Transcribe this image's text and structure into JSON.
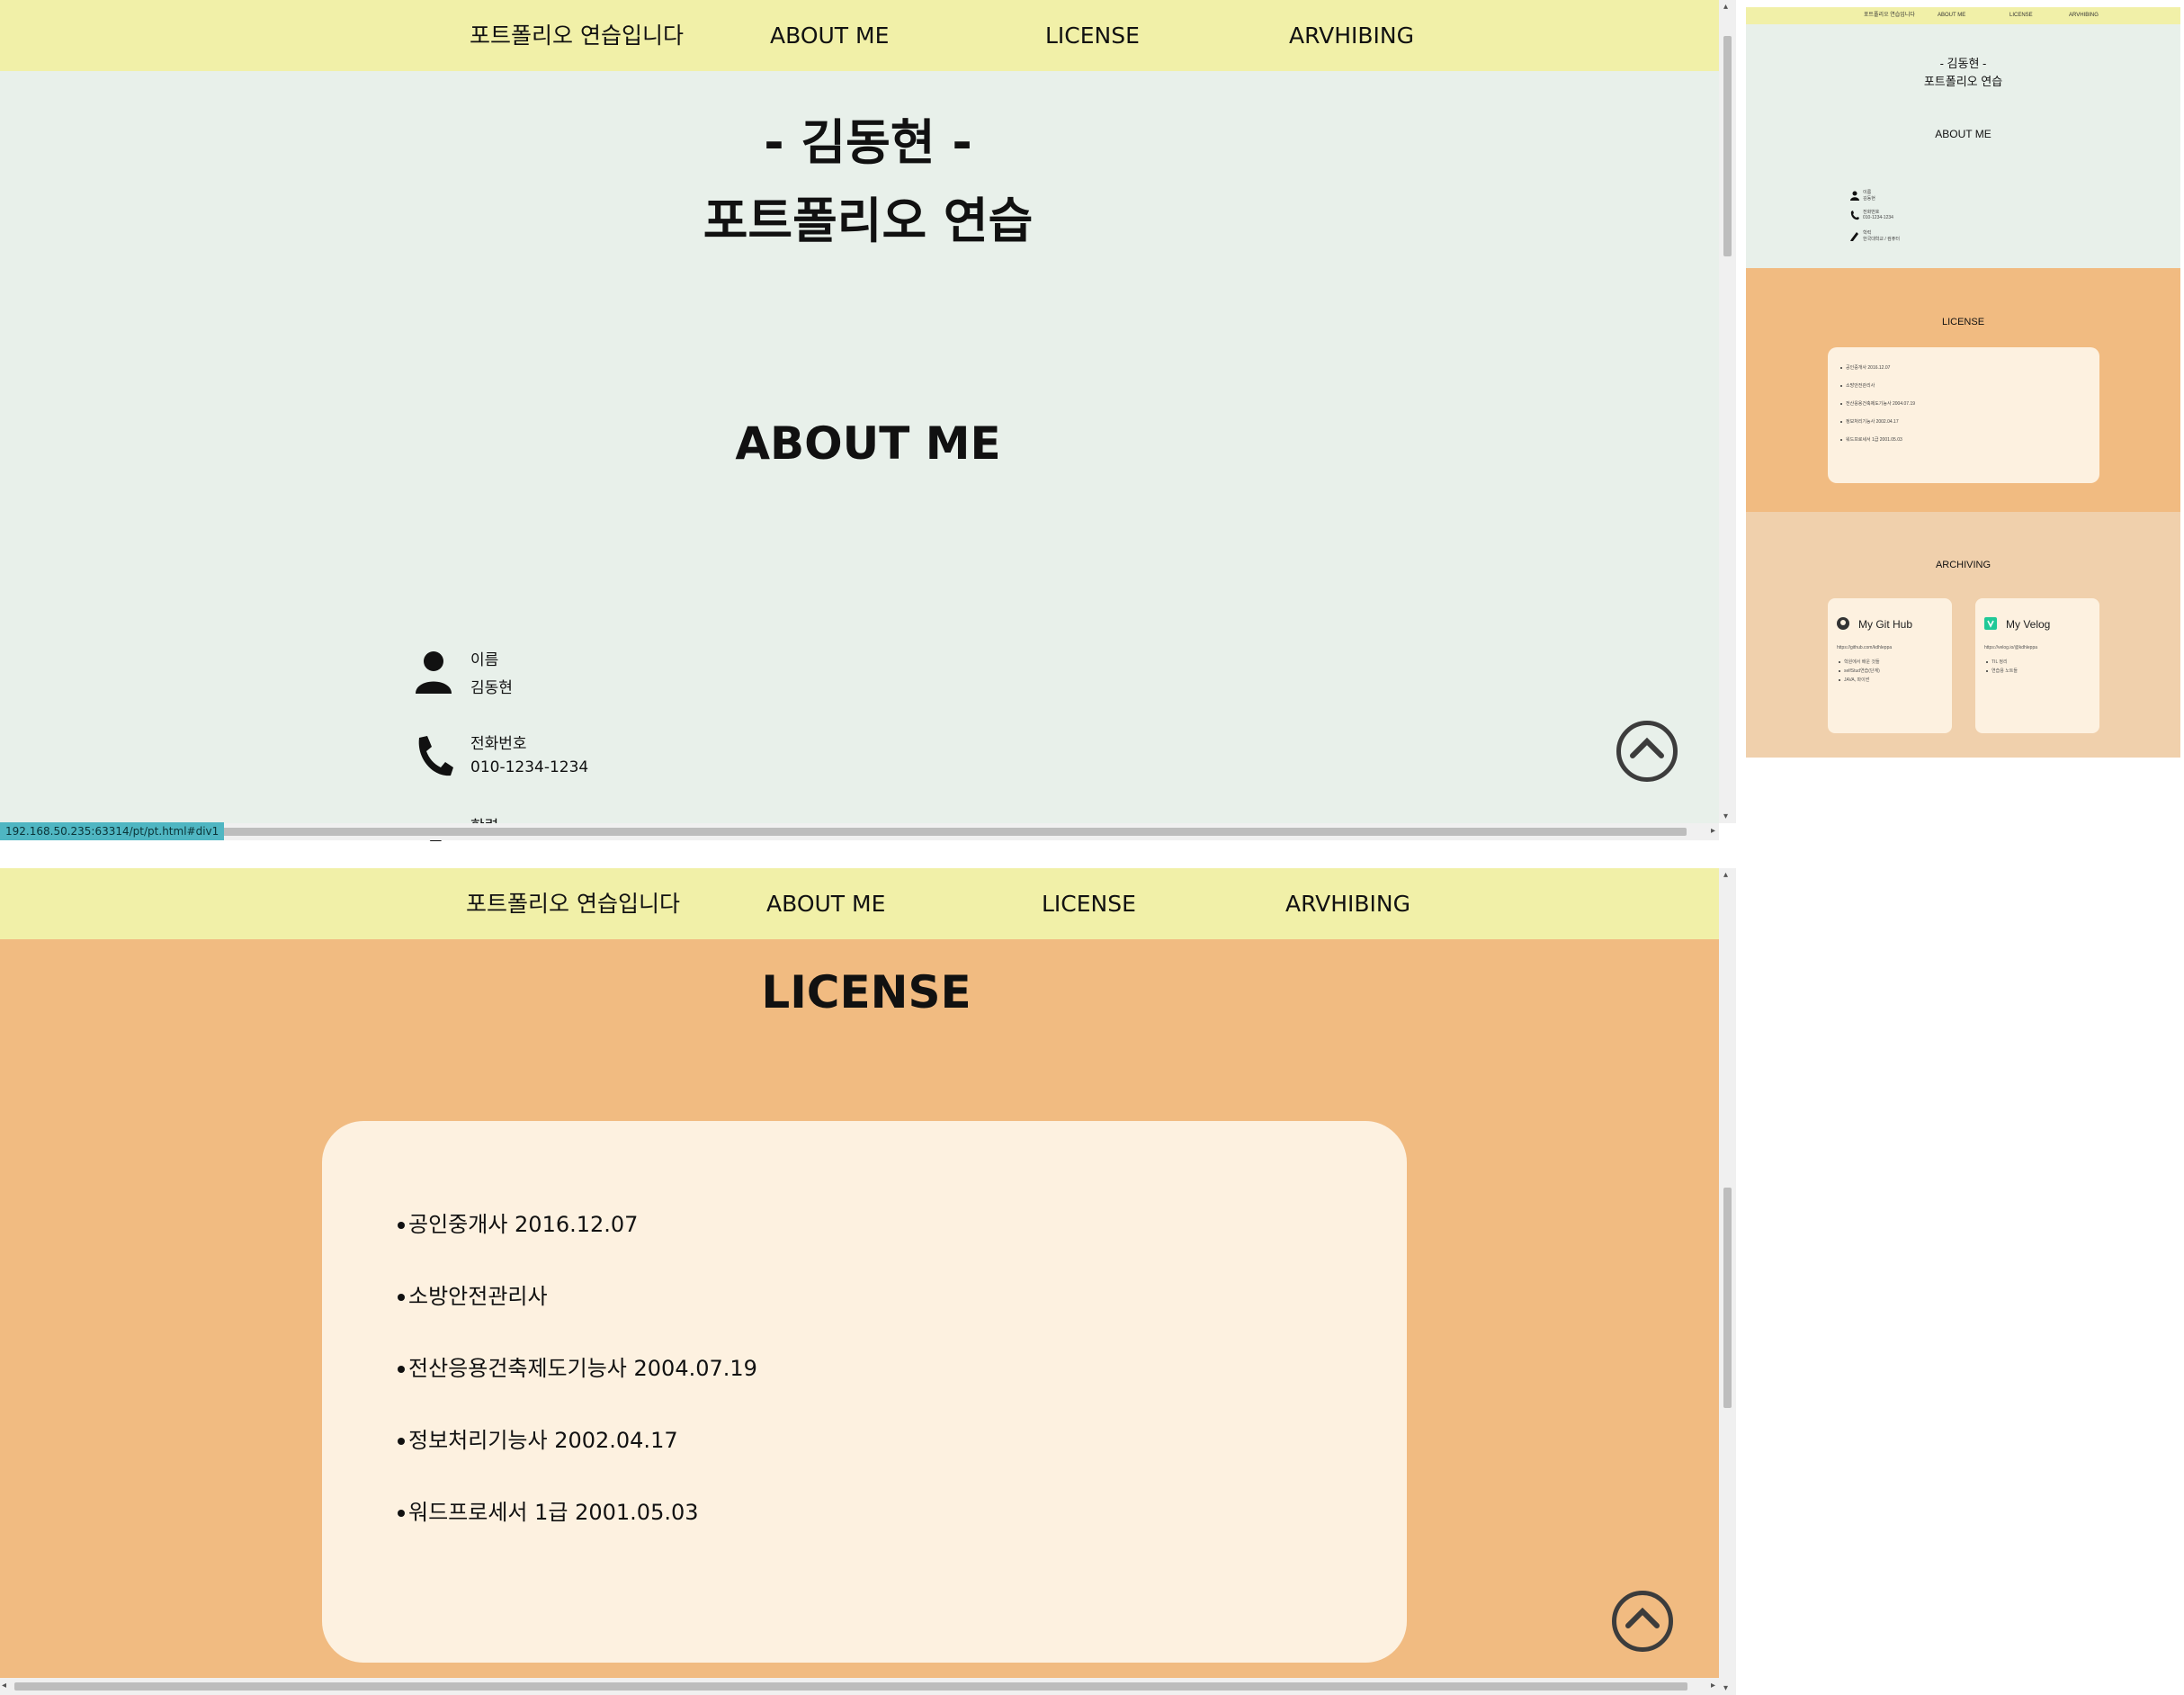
{
  "nav": {
    "items": [
      "포트폴리오 연습입니다",
      "ABOUT ME",
      "LICENSE",
      "ARVHIBING"
    ]
  },
  "about": {
    "name_line": "- 김동현 -",
    "subtitle": "포트폴리오 연습",
    "section_title": "ABOUT ME",
    "rows": [
      {
        "icon": "person-icon",
        "label": "이름",
        "value": "김동현"
      },
      {
        "icon": "phone-icon",
        "label": "전화번호",
        "value": "010-1234-1234"
      },
      {
        "icon": "pencil-icon",
        "label": "학력",
        "value": ""
      }
    ]
  },
  "license": {
    "section_title": "LICENSE",
    "items": [
      "공인중개사 2016.12.07",
      "소방안전관리사",
      "전산응용건축제도기능사 2004.07.19",
      "정보처리기능사 2002.04.17",
      "워드프로세서 1급 2001.05.03"
    ]
  },
  "status_url": "192.168.50.235:63314/pt/pt.html#div1",
  "overview": {
    "nav": [
      "포트폴리오 연습입니다",
      "ABOUT ME",
      "LICENSE",
      "ARVHIBING"
    ],
    "name_line": "- 김동현 -",
    "subtitle": "포트폴리오 연습",
    "about_title": "ABOUT ME",
    "rows": [
      {
        "label": "이름",
        "value": "김동현"
      },
      {
        "label": "전화번호",
        "value": "010-1234-1234"
      },
      {
        "label": "학력",
        "value": "한국대학교 / 컴퓨터"
      }
    ],
    "license_title": "LICENSE",
    "license_items": [
      "공인중개사 2016.12.07",
      "소방안전관리사",
      "전산응용건축제도기능사 2004.07.19",
      "정보처리기능사 2002.04.17",
      "워드프로세서 1급 2001.05.03"
    ],
    "archiving_title": "ARCHIVING",
    "cards": [
      {
        "title": "My Git Hub",
        "url": "https://github.com/kdhleppa",
        "items": [
          "학원에서 배운 것들",
          "selfStud연습(단계)",
          "JAVA, 파이썬"
        ]
      },
      {
        "title": "My Velog",
        "url": "https://velog.io/@kdhleppa",
        "items": [
          "TIL 정리",
          "연습용 노트들"
        ]
      }
    ]
  },
  "colors": {
    "nav_bg": "#f1f0a8",
    "about_bg": "#e8f0ea",
    "license_bg": "#f1bb81",
    "archiving_bg": "#f0d0ac",
    "card_bg": "#fdf1e0",
    "status_bg": "#4fb6c2"
  }
}
